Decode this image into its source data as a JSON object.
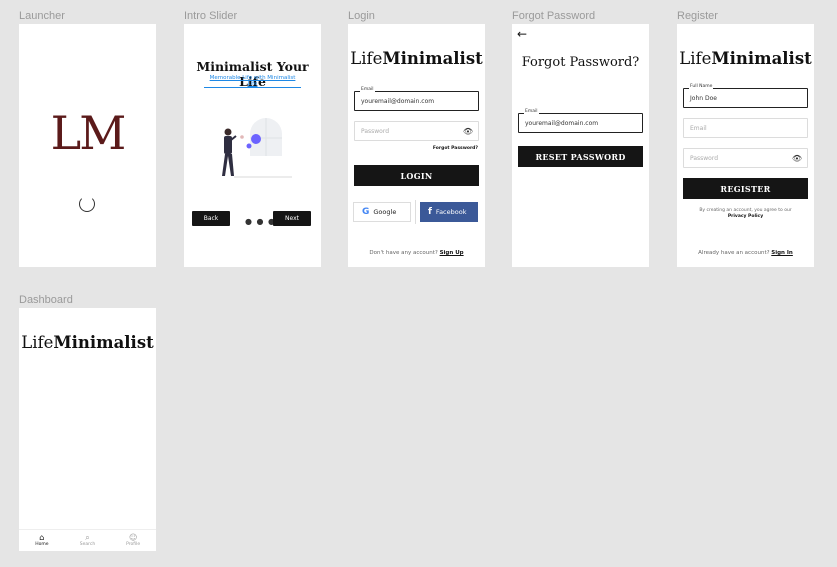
{
  "frames": {
    "launcher": {
      "label": "Launcher",
      "logo": "LM"
    },
    "intro": {
      "label": "Intro Slider",
      "title": "Minimalist Your Life",
      "subtitle": "Memorable Life with Minimalist Life",
      "back": "Back",
      "next": "Next",
      "dots": "● ● ●"
    },
    "login": {
      "label": "Login",
      "brand_light": "Life",
      "brand_bold": "Minimalist",
      "email_legend": "Email",
      "email_value": "youremail@domain.com",
      "password_placeholder": "Password",
      "forgot": "Forgot Password?",
      "button": "LOGIN",
      "google": "Google",
      "facebook": "Facebook",
      "footer_text": "Don't have any account?",
      "footer_link": "Sign Up"
    },
    "forgot": {
      "label": "Forgot Password",
      "title": "Forgot Password?",
      "email_legend": "Email",
      "email_value": "youremail@domain.com",
      "button": "RESET PASSWORD"
    },
    "register": {
      "label": "Register",
      "brand_light": "Life",
      "brand_bold": "Minimalist",
      "name_legend": "Full Name",
      "name_value": "John Doe",
      "email_placeholder": "Email",
      "password_placeholder": "Password",
      "button": "REGISTER",
      "terms_text": "By creating an account, you agree to our",
      "terms_link": "Privacy Policy",
      "footer_text": "Already have an account?",
      "footer_link": "Sign In"
    },
    "dashboard": {
      "label": "Dashboard",
      "brand_light": "Life",
      "brand_bold": "Minimalist",
      "nav": [
        {
          "label": "Home",
          "icon": "home-icon"
        },
        {
          "label": "Search",
          "icon": "search-icon"
        },
        {
          "label": "Profile",
          "icon": "profile-icon"
        }
      ]
    }
  },
  "colors": {
    "logo": "#5b1a1a",
    "button": "#151515",
    "facebook": "#3b5998",
    "link": "#1e88e5"
  }
}
